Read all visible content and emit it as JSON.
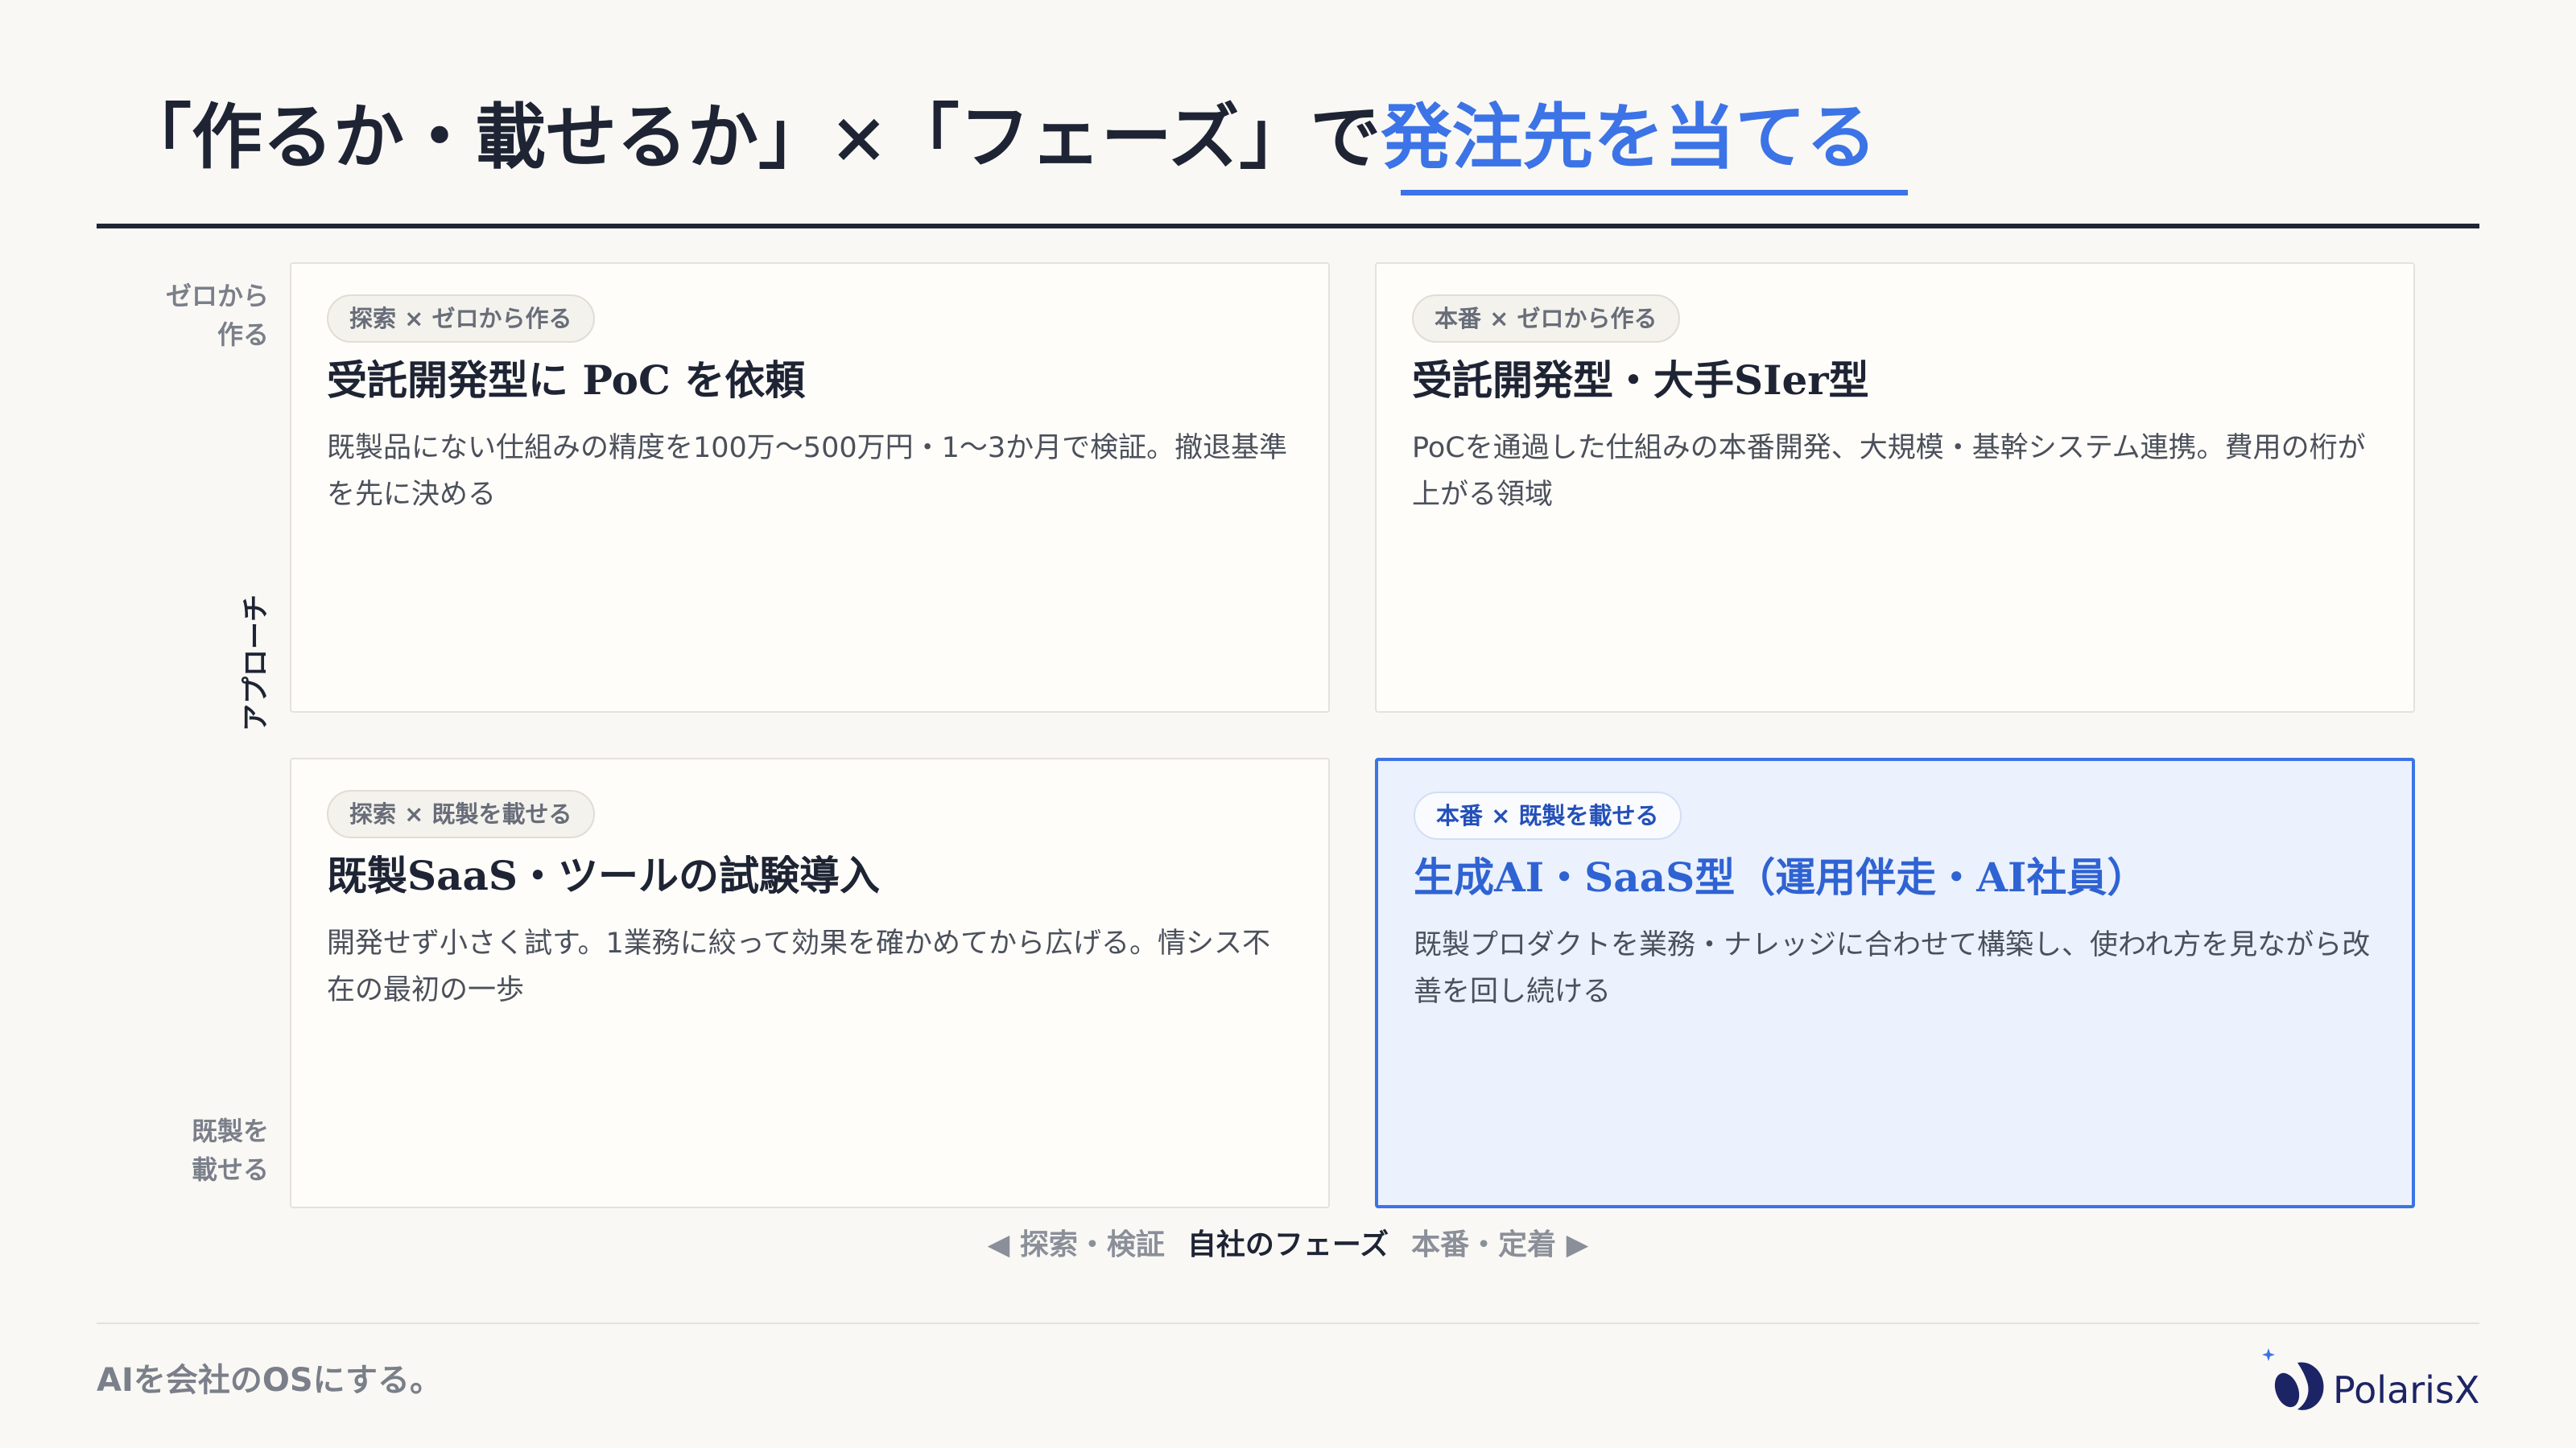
{
  "title": {
    "prefix": "「作るか・載せるか」×「フェーズ」で",
    "highlight": "発注先を当てる"
  },
  "y_axis": {
    "title": "アプローチ",
    "top_label": "ゼロから\n作る",
    "bottom_label": "既製を\n載せる"
  },
  "x_axis": {
    "left_label": "◀ 探索・検証",
    "title": "自社のフェーズ",
    "right_label": "本番・定着 ▶"
  },
  "quadrants": [
    {
      "tag": "探索 × ゼロから作る",
      "title": "受託開発型に PoC を依頼",
      "description": "既製品にない仕組みの精度を100万〜500万円・1〜3か月で検証。撤退基準を先に決める"
    },
    {
      "tag": "本番 × ゼロから作る",
      "title": "受託開発型・大手SIer型",
      "description": "PoCを通過した仕組みの本番開発、大規模・基幹システム連携。費用の桁が上がる領域"
    },
    {
      "tag": "探索 × 既製を載せる",
      "title": "既製SaaS・ツールの試験導入",
      "description": "開発せず小さく試す。1業務に絞って効果を確かめてから広げる。情シス不在の最初の一歩"
    },
    {
      "tag": "本番 × 既製を載せる",
      "title": "生成AI・SaaS型（運用伴走・AI社員）",
      "description": "既製プロダクトを業務・ナレッジに合わせて構築し、使われ方を見ながら改善を回し続ける"
    }
  ],
  "footer": {
    "tagline": "AIを会社のOSにする。",
    "brand": "PolarisX"
  },
  "colors": {
    "accent": "#3c73e6",
    "ink": "#1e2434",
    "background": "#f9f8f4"
  }
}
